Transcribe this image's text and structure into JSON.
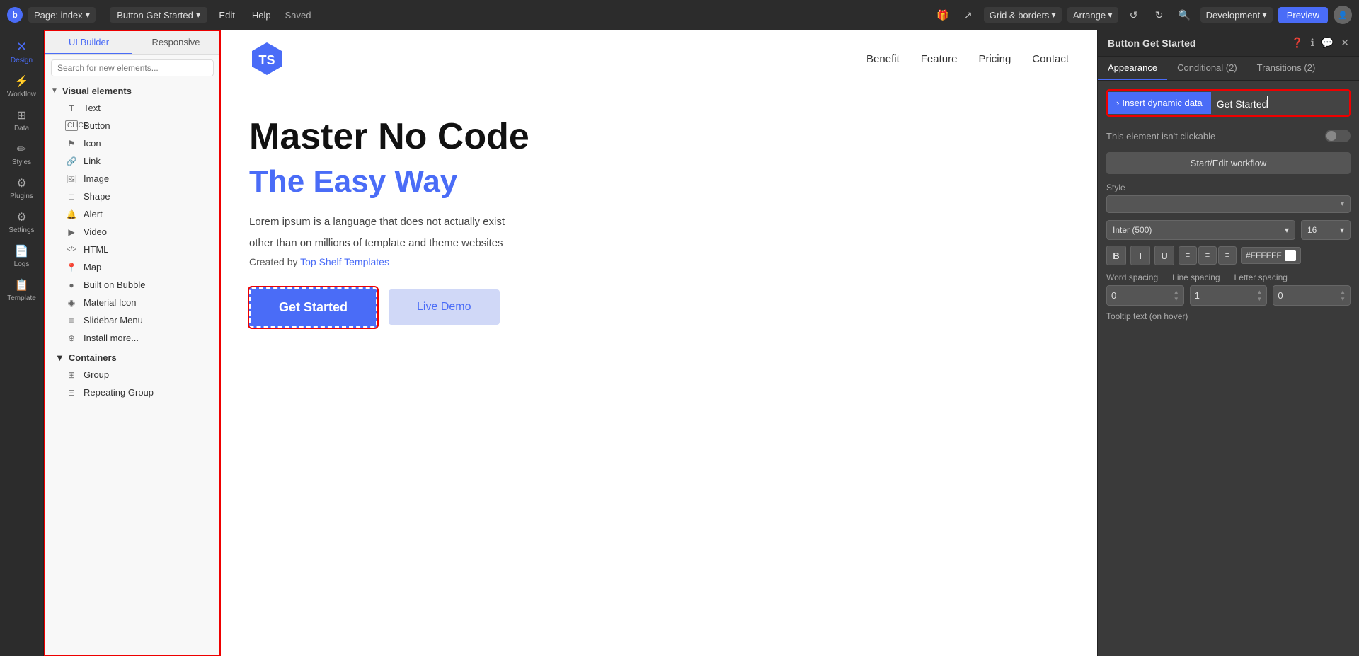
{
  "topbar": {
    "logo": "b",
    "page_label": "Page: index",
    "element_label": "Button Get Started",
    "edit_label": "Edit",
    "help_label": "Help",
    "saved_label": "Saved",
    "grid_label": "Grid & borders",
    "arrange_label": "Arrange",
    "dev_label": "Development",
    "preview_label": "Preview"
  },
  "left_sidebar": {
    "items": [
      {
        "id": "design",
        "label": "Design",
        "icon": "✕"
      },
      {
        "id": "workflow",
        "label": "Workflow",
        "icon": "⚡"
      },
      {
        "id": "data",
        "label": "Data",
        "icon": "⊞"
      },
      {
        "id": "styles",
        "label": "Styles",
        "icon": "✏"
      },
      {
        "id": "plugins",
        "label": "Plugins",
        "icon": "⚙"
      },
      {
        "id": "settings",
        "label": "Settings",
        "icon": "⚙"
      },
      {
        "id": "logs",
        "label": "Logs",
        "icon": "📄"
      },
      {
        "id": "template",
        "label": "Template",
        "icon": "📋"
      }
    ]
  },
  "elements_panel": {
    "tabs": [
      "UI Builder",
      "Responsive"
    ],
    "search_placeholder": "Search for new elements...",
    "visual_elements_label": "Visual elements",
    "items": [
      {
        "id": "text",
        "label": "Text",
        "icon": "T"
      },
      {
        "id": "button",
        "label": "Button",
        "icon": "□"
      },
      {
        "id": "icon",
        "label": "Icon",
        "icon": "⚑"
      },
      {
        "id": "link",
        "label": "Link",
        "icon": "🔗"
      },
      {
        "id": "image",
        "label": "Image",
        "icon": "🖼"
      },
      {
        "id": "shape",
        "label": "Shape",
        "icon": "□"
      },
      {
        "id": "alert",
        "label": "Alert",
        "icon": "🔔"
      },
      {
        "id": "video",
        "label": "Video",
        "icon": "▶"
      },
      {
        "id": "html",
        "label": "HTML",
        "icon": "</>"
      },
      {
        "id": "map",
        "label": "Map",
        "icon": "📍"
      },
      {
        "id": "built-on-bubble",
        "label": "Built on Bubble",
        "icon": "●"
      },
      {
        "id": "material-icon",
        "label": "Material Icon",
        "icon": "◉"
      },
      {
        "id": "slidebar-menu",
        "label": "Slidebar Menu",
        "icon": "≡"
      },
      {
        "id": "install-more",
        "label": "Install more...",
        "icon": "⊕"
      }
    ],
    "containers_label": "Containers",
    "containers": [
      {
        "id": "group",
        "label": "Group",
        "icon": "⊞"
      },
      {
        "id": "repeating-group",
        "label": "Repeating Group",
        "icon": "⊟"
      }
    ]
  },
  "site": {
    "nav_links": [
      "Benefit",
      "Feature",
      "Pricing",
      "Contact"
    ],
    "hero_title": "Master No Code",
    "hero_subtitle": "The Easy Way",
    "hero_desc_1": "Lorem ipsum is a language that does not actually exist",
    "hero_desc_2": "other than on millions of template and theme websites",
    "hero_created": "Created by ",
    "hero_creator": "Top Shelf Templates",
    "btn_get_started": "Get Started",
    "btn_live_demo": "Live Demo"
  },
  "right_panel": {
    "title": "Button Get Started",
    "tabs": [
      "Appearance",
      "Conditional (2)",
      "Transitions (2)"
    ],
    "active_tab": "Appearance",
    "insert_dynamic_label": "Insert dynamic data",
    "input_value": "Get Started",
    "not_clickable_label": "This element isn't clickable",
    "workflow_btn_label": "Start/Edit workflow",
    "style_label": "Style",
    "font_label": "Inter (500)",
    "font_size": "16",
    "color_hex": "#FFFFFF",
    "bold_label": "B",
    "italic_label": "I",
    "underline_label": "U",
    "word_spacing_label": "Word spacing",
    "line_spacing_label": "Line spacing",
    "letter_spacing_label": "Letter spacing",
    "word_spacing_val": "0",
    "line_spacing_val": "1",
    "letter_spacing_val": "0",
    "tooltip_label": "Tooltip text (on hover)"
  }
}
